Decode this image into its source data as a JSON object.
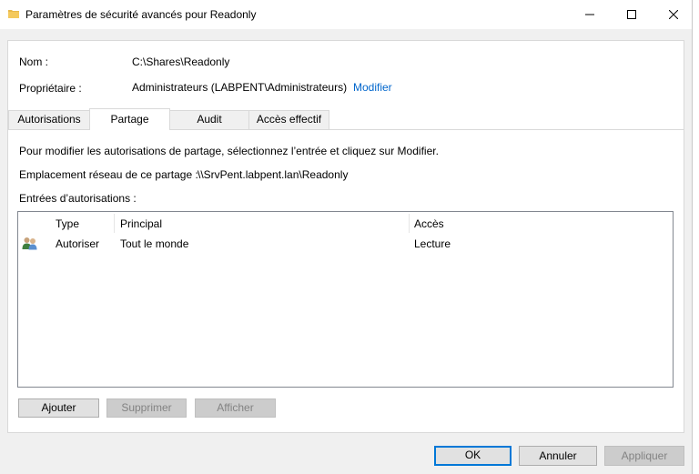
{
  "window": {
    "title": "Paramètres de sécurité avancés pour Readonly",
    "minimize_label": "—",
    "maximize_label": "☐",
    "close_label": "✕"
  },
  "header": {
    "name_label": "Nom :",
    "name_value": "C:\\Shares\\Readonly",
    "owner_label": "Propriétaire :",
    "owner_value": "Administrateurs (LABPENT\\Administrateurs)",
    "owner_link": "Modifier"
  },
  "tabs": [
    {
      "label": "Autorisations",
      "active": false
    },
    {
      "label": "Partage",
      "active": true
    },
    {
      "label": "Audit",
      "active": false
    },
    {
      "label": "Accès effectif",
      "active": false
    }
  ],
  "share": {
    "instructions": "Pour modifier les autorisations de partage, sélectionnez l’entrée et cliquez sur Modifier.",
    "network_label": "Emplacement réseau de ce partage :",
    "network_path": "\\\\SrvPent.labpent.lan\\Readonly",
    "entries_label": "Entrées d’autorisations :",
    "columns": [
      "Type",
      "Principal",
      "Accès"
    ],
    "rows": [
      {
        "icon": "users-icon",
        "type": "Autoriser",
        "principal": "Tout le monde",
        "access": "Lecture"
      }
    ],
    "buttons": {
      "add": "Ajouter",
      "remove": "Supprimer",
      "view": "Afficher"
    }
  },
  "footer": {
    "ok": "OK",
    "cancel": "Annuler",
    "apply": "Appliquer"
  },
  "colors": {
    "accent": "#0078d7",
    "link": "#0066cc",
    "folder": "#e8b84a"
  }
}
